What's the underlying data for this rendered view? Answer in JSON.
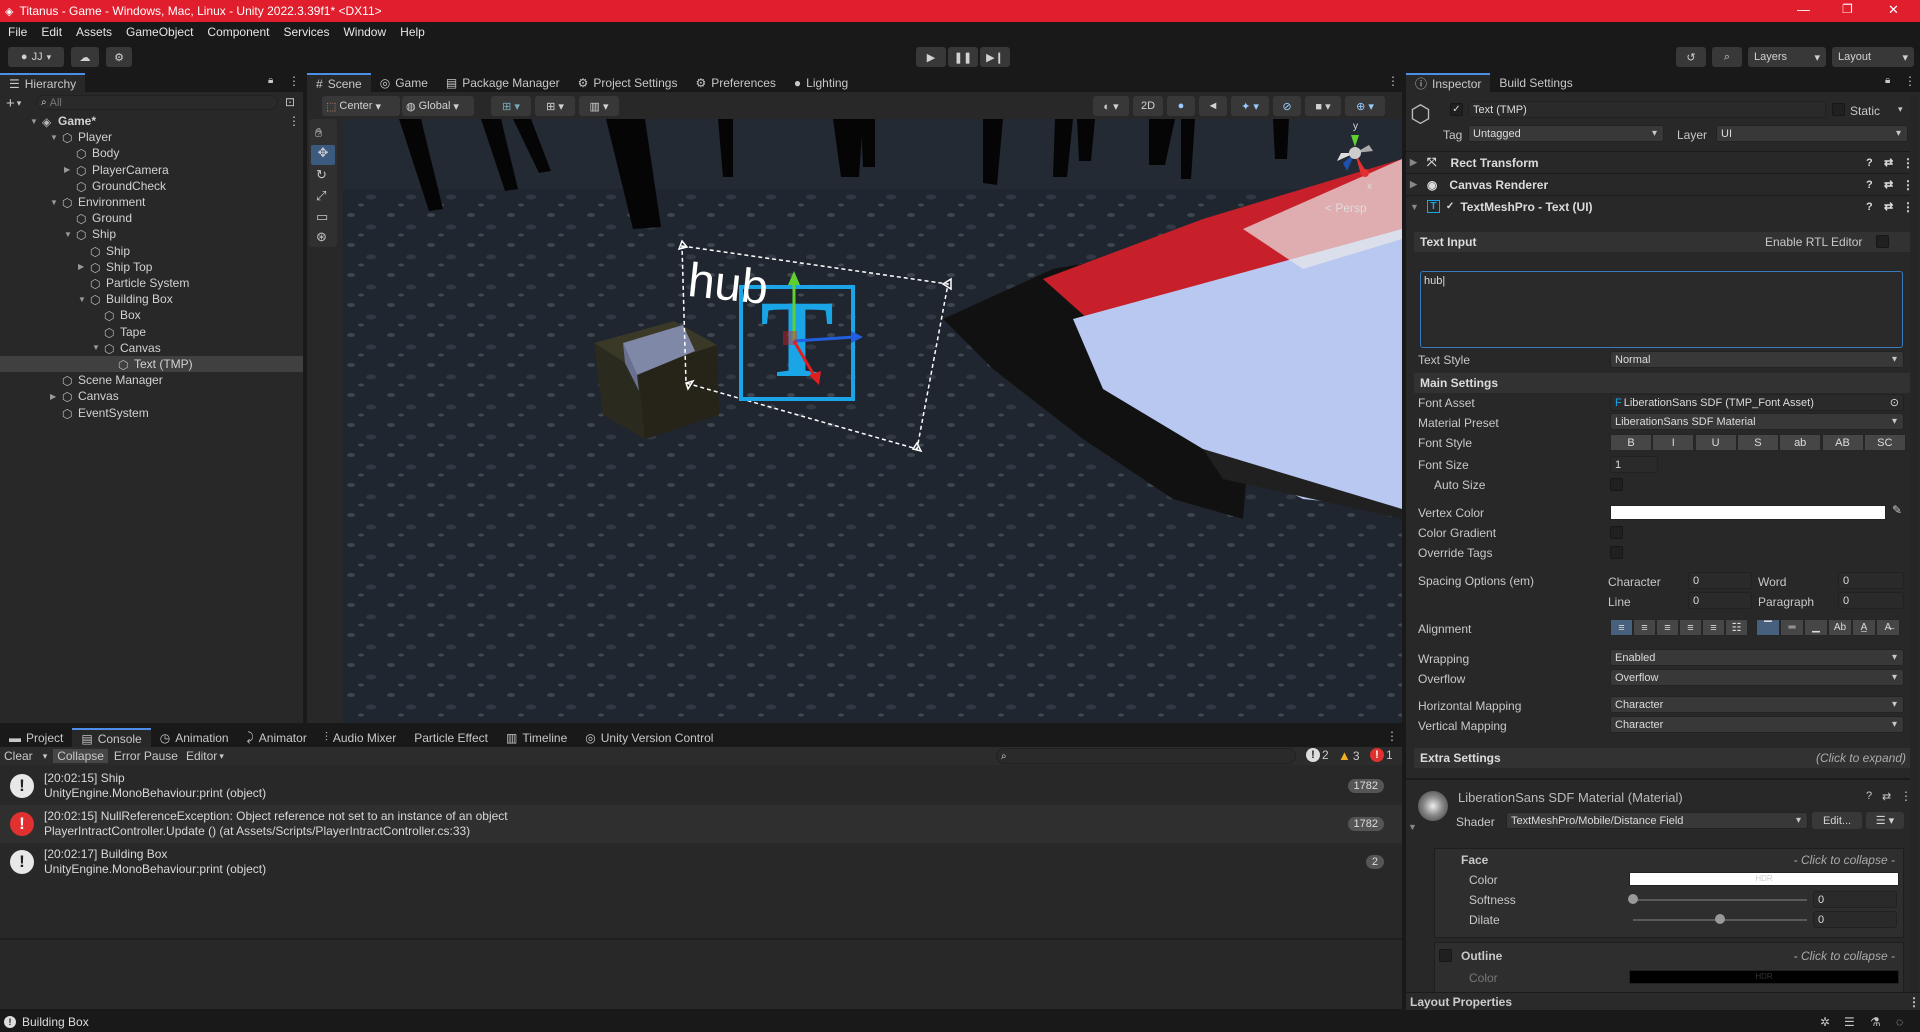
{
  "title_bar": {
    "title": "Titanus - Game - Windows, Mac, Linux - Unity 2022.3.39f1* <DX11>"
  },
  "menu": [
    "File",
    "Edit",
    "Assets",
    "GameObject",
    "Component",
    "Services",
    "Window",
    "Help"
  ],
  "toolbar": {
    "account": "JJ",
    "layers_label": "Layers",
    "layout_label": "Layout"
  },
  "hierarchy": {
    "tab": "Hierarchy",
    "search_placeholder": "All",
    "items": [
      {
        "label": "Game*"
      },
      {
        "label": "Player"
      },
      {
        "label": "Body"
      },
      {
        "label": "PlayerCamera"
      },
      {
        "label": "GroundCheck"
      },
      {
        "label": "Environment"
      },
      {
        "label": "Ground"
      },
      {
        "label": "Ship"
      },
      {
        "label": "Ship"
      },
      {
        "label": "Ship Top"
      },
      {
        "label": "Particle System"
      },
      {
        "label": "Building Box"
      },
      {
        "label": "Box"
      },
      {
        "label": "Tape"
      },
      {
        "label": "Canvas"
      },
      {
        "label": "Text (TMP)"
      },
      {
        "label": "Scene Manager"
      },
      {
        "label": "Canvas"
      },
      {
        "label": "EventSystem"
      }
    ]
  },
  "scene_tabs": [
    "Scene",
    "Game",
    "Package Manager",
    "Project Settings",
    "Preferences",
    "Lighting"
  ],
  "scene_toolbar": {
    "pivot": "Center",
    "space": "Global",
    "mode_2d": "2D"
  },
  "scene_view": {
    "hub_text": "hub",
    "persp_label": "< Persp",
    "gizmo_y": "y",
    "gizmo_x": "x"
  },
  "bottom_tabs": [
    "Project",
    "Console",
    "Animation",
    "Animator",
    "Audio Mixer",
    "Particle Effect",
    "Timeline",
    "Unity Version Control"
  ],
  "console": {
    "buttons": [
      "Clear",
      "Collapse",
      "Error Pause",
      "Editor"
    ],
    "counts": {
      "info": "2",
      "warn": "3",
      "error": "1"
    },
    "entries": [
      {
        "line1": "[20:02:15] Ship",
        "line2": "UnityEngine.MonoBehaviour:print (object)",
        "count": "1782",
        "type": "info"
      },
      {
        "line1": "[20:02:15] NullReferenceException: Object reference not set to an instance of an object",
        "line2": "PlayerIntractController.Update () (at Assets/Scripts/PlayerIntractController.cs:33)",
        "count": "1782",
        "type": "error"
      },
      {
        "line1": "[20:02:17] Building Box",
        "line2": "UnityEngine.MonoBehaviour:print (object)",
        "count": "2",
        "type": "info"
      }
    ]
  },
  "status_bar": {
    "text": "Building Box"
  },
  "inspector": {
    "tabs": [
      "Inspector",
      "Build Settings"
    ],
    "object_name": "Text (TMP)",
    "static_label": "Static",
    "tag_label": "Tag",
    "tag_value": "Untagged",
    "layer_label": "Layer",
    "layer_value": "UI",
    "components": [
      "Rect Transform",
      "Canvas Renderer",
      "TextMeshPro - Text (UI)"
    ],
    "text_input": {
      "header": "Text Input",
      "rtl": "Enable RTL Editor",
      "value": "hub"
    },
    "text_style": {
      "label": "Text Style",
      "value": "Normal"
    },
    "main_settings": "Main Settings",
    "font_asset": {
      "label": "Font Asset",
      "value": "LiberationSans SDF (TMP_Font Asset)"
    },
    "material_preset": {
      "label": "Material Preset",
      "value": "LiberationSans SDF Material"
    },
    "font_style": {
      "label": "Font Style",
      "buttons": [
        "B",
        "I",
        "U",
        "S",
        "ab",
        "AB",
        "SC"
      ]
    },
    "font_size": {
      "label": "Font Size",
      "value": "1"
    },
    "auto_size": "Auto Size",
    "vertex_color": {
      "label": "Vertex Color",
      "color": "#ffffff"
    },
    "color_gradient": "Color Gradient",
    "override_tags": "Override Tags",
    "spacing": {
      "label": "Spacing Options (em)",
      "character": "Character",
      "character_value": "0",
      "word": "Word",
      "word_value": "0",
      "line": "Line",
      "line_value": "0",
      "paragraph": "Paragraph",
      "paragraph_value": "0"
    },
    "alignment": "Alignment",
    "wrapping": {
      "label": "Wrapping",
      "value": "Enabled"
    },
    "overflow": {
      "label": "Overflow",
      "value": "Overflow"
    },
    "horizontal_mapping": {
      "label": "Horizontal Mapping",
      "value": "Character"
    },
    "vertical_mapping": {
      "label": "Vertical Mapping",
      "value": "Character"
    },
    "extra_settings": {
      "label": "Extra Settings",
      "hint": "(Click to expand)"
    },
    "material": {
      "name": "LiberationSans SDF Material (Material)",
      "shader_label": "Shader",
      "shader_value": "TextMeshPro/Mobile/Distance Field",
      "edit": "Edit..."
    },
    "face": {
      "label": "Face",
      "hint": "- Click to collapse -",
      "color_label": "Color",
      "hdr": "HDR",
      "softness_label": "Softness",
      "softness_value": "0",
      "dilate_label": "Dilate",
      "dilate_value": "0"
    },
    "outline": {
      "label": "Outline",
      "hint": "- Click to collapse -",
      "color_label": "Color",
      "hdr": "HDR"
    },
    "layout_properties": "Layout Properties"
  }
}
